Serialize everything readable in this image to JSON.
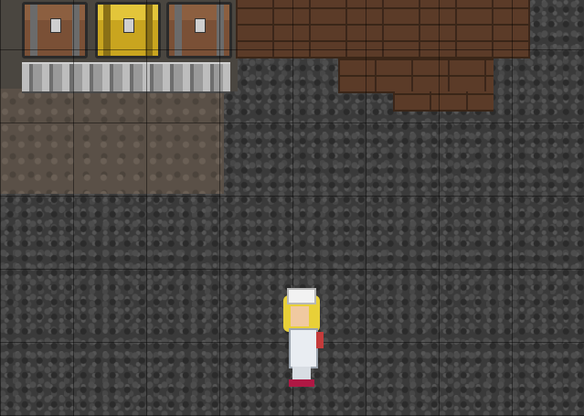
{
  "scene": {
    "name": "underground-storage-room",
    "tiles": [
      "stone-block-background",
      "dirt-wall",
      "wooden-wall"
    ],
    "containers": [
      {
        "type": "wooden-chest"
      },
      {
        "type": "gold-chest"
      },
      {
        "type": "wooden-chest"
      }
    ],
    "furniture": [
      "stone-shelf"
    ],
    "character": {
      "role": "player",
      "hair": "blonde",
      "outfit": "white-nurse"
    }
  },
  "colors": {
    "stone": "#3a3a3a",
    "dirt": "#5a5047",
    "wood": "#5b3b28",
    "gold": "#c9a51f"
  },
  "hud": {}
}
